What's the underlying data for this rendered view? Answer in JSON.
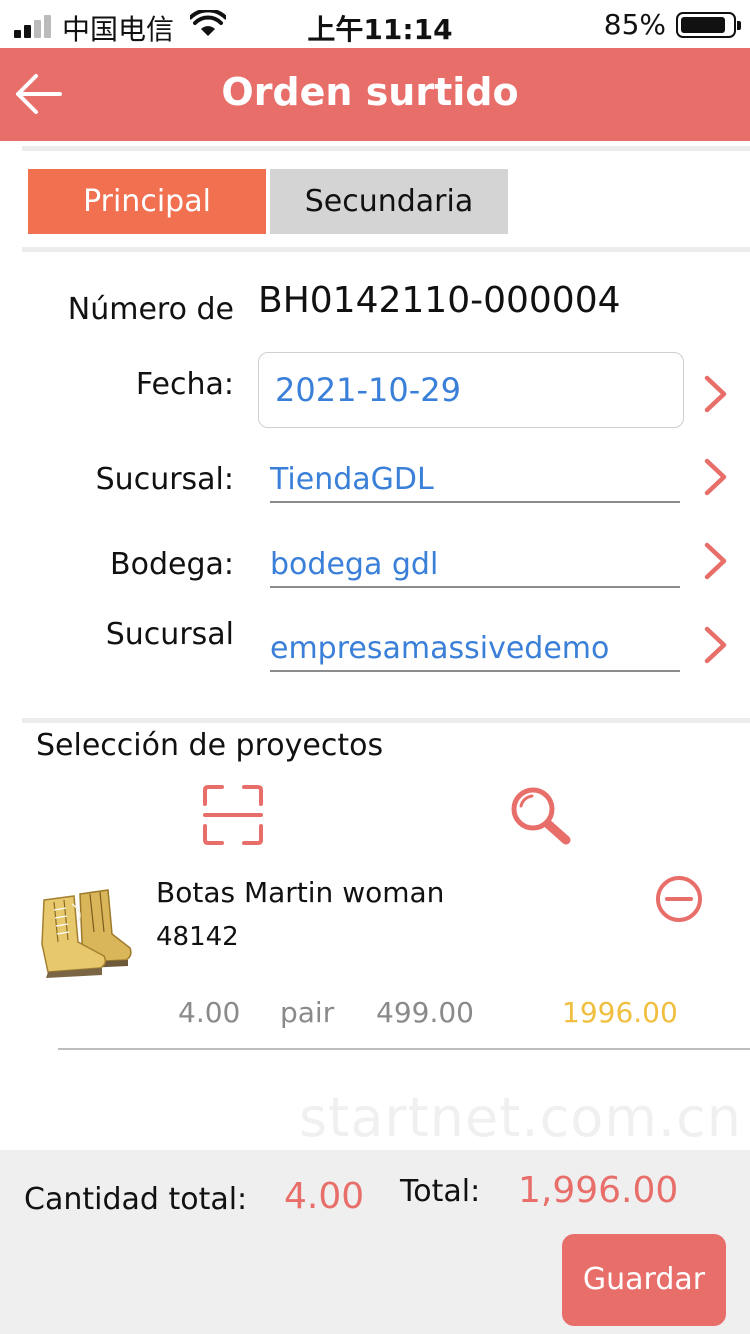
{
  "status_bar": {
    "carrier": "中国电信",
    "time": "上午11:14",
    "battery": "85%"
  },
  "header": {
    "title": "Orden surtido",
    "back_icon": "arrow-left-icon"
  },
  "tabs": [
    {
      "label": "Principal",
      "active": true
    },
    {
      "label": "Secundaria",
      "active": false
    }
  ],
  "form": {
    "number_label": "Número de",
    "number_value": "BH0142110-000004",
    "date_label": "Fecha:",
    "date_value": "2021-10-29",
    "branch_label": "Sucursal:",
    "branch_value": "TiendaGDL",
    "warehouse_label": "Bodega:",
    "warehouse_value": "bodega gdl",
    "company_label": "Sucursal",
    "company_value": "empresamassivedemo"
  },
  "projects": {
    "title": "Selección de proyectos",
    "scan_icon": "scan-icon",
    "search_icon": "search-icon"
  },
  "items": [
    {
      "name": "Botas Martin woman",
      "code": "48142",
      "quantity": "4.00",
      "unit": "pair",
      "price": "499.00",
      "amount": "1996.00"
    }
  ],
  "watermark": "startnet.com.cn",
  "footer": {
    "quantity_label": "Cantidad total:",
    "quantity_value": "4.00",
    "total_label": "Total:",
    "total_value": "1,996.00",
    "save_label": "Guardar"
  },
  "colors": {
    "accent": "#e86e6a",
    "tab_active": "#f07050",
    "link": "#3a7fd8",
    "amount": "#f0bf40"
  }
}
